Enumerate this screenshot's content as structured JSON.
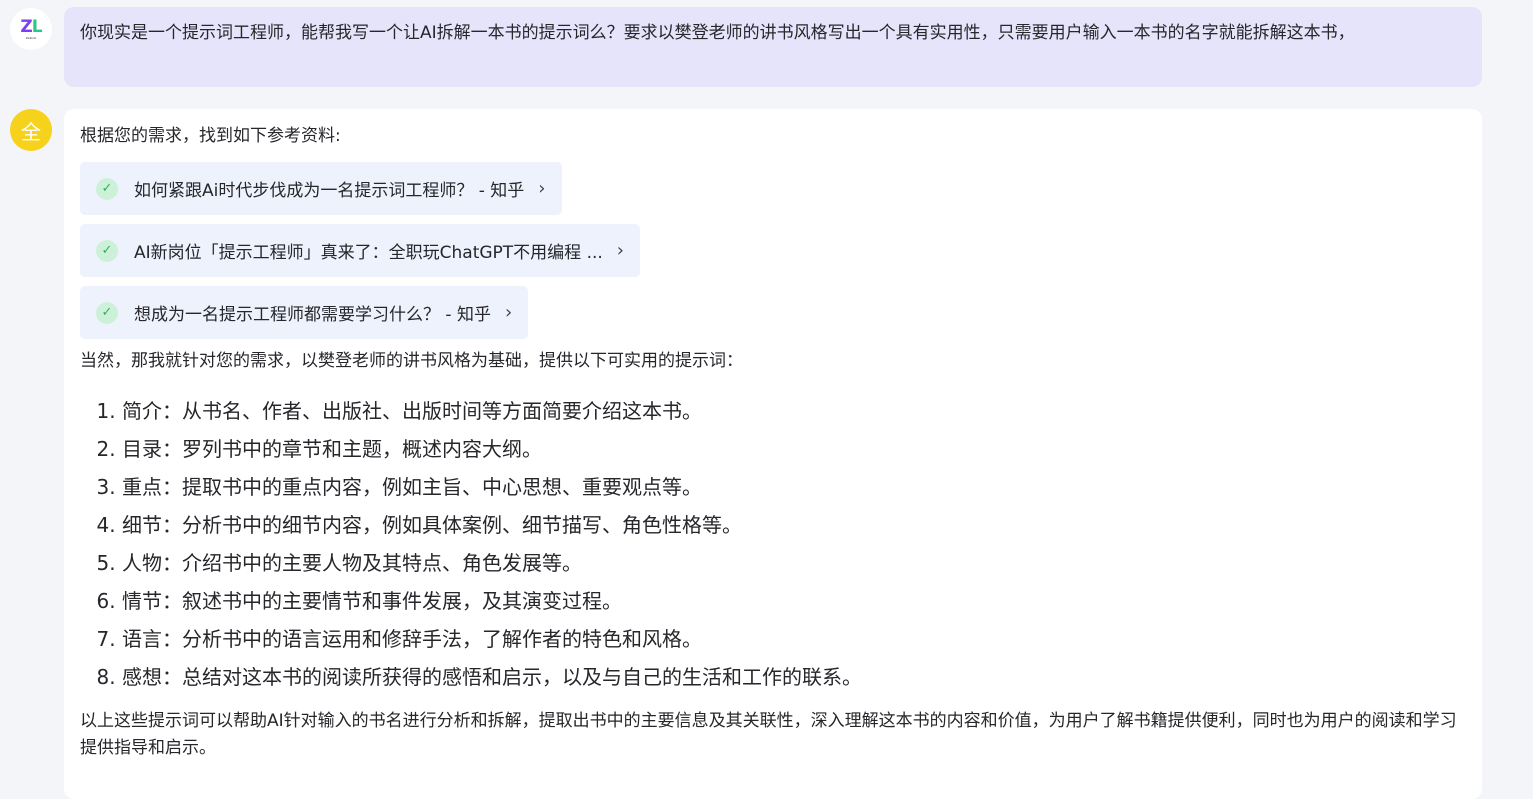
{
  "user": {
    "avatar_logo": "ZL",
    "avatar_logo_sub": "ZelinAI",
    "message": "你现实是一个提示词工程师，能帮我写一个让AI拆解一本书的提示词么？要求以樊登老师的讲书风格写出一个具有实用性，只需要用户输入一本书的名字就能拆解这本书，"
  },
  "assistant": {
    "avatar_text": "全",
    "intro": "根据您的需求，找到如下参考资料:",
    "references": [
      {
        "title": "如何紧跟Ai时代步伐成为一名提示词工程师？ - 知乎"
      },
      {
        "title": "AI新岗位「提示工程师」真来了：全职玩ChatGPT不用编程 ..."
      },
      {
        "title": "想成为一名提示工程师都需要学习什么？ - 知乎"
      }
    ],
    "lead": "当然，那我就针对您的需求，以樊登老师的讲书风格为基础，提供以下可实用的提示词：",
    "items": [
      "简介：从书名、作者、出版社、出版时间等方面简要介绍这本书。",
      "目录：罗列书中的章节和主题，概述内容大纲。",
      "重点：提取书中的重点内容，例如主旨、中心思想、重要观点等。",
      "细节：分析书中的细节内容，例如具体案例、细节描写、角色性格等。",
      "人物：介绍书中的主要人物及其特点、角色发展等。",
      "情节：叙述书中的主要情节和事件发展，及其演变过程。",
      "语言：分析书中的语言运用和修辞手法，了解作者的特色和风格。",
      "感想：总结对这本书的阅读所获得的感悟和启示，以及与自己的生活和工作的联系。"
    ],
    "outro": "以上这些提示词可以帮助AI针对输入的书名进行分析和拆解，提取出书中的主要信息及其关联性，深入理解这本书的内容和价值，为用户了解书籍提供便利，同时也为用户的阅读和学习提供指导和启示。"
  },
  "colors": {
    "user_bubble": "#e6e4fb",
    "bot_avatar": "#f7d21d",
    "reference_bg": "#eef2fd",
    "check": "#2fb35b"
  }
}
